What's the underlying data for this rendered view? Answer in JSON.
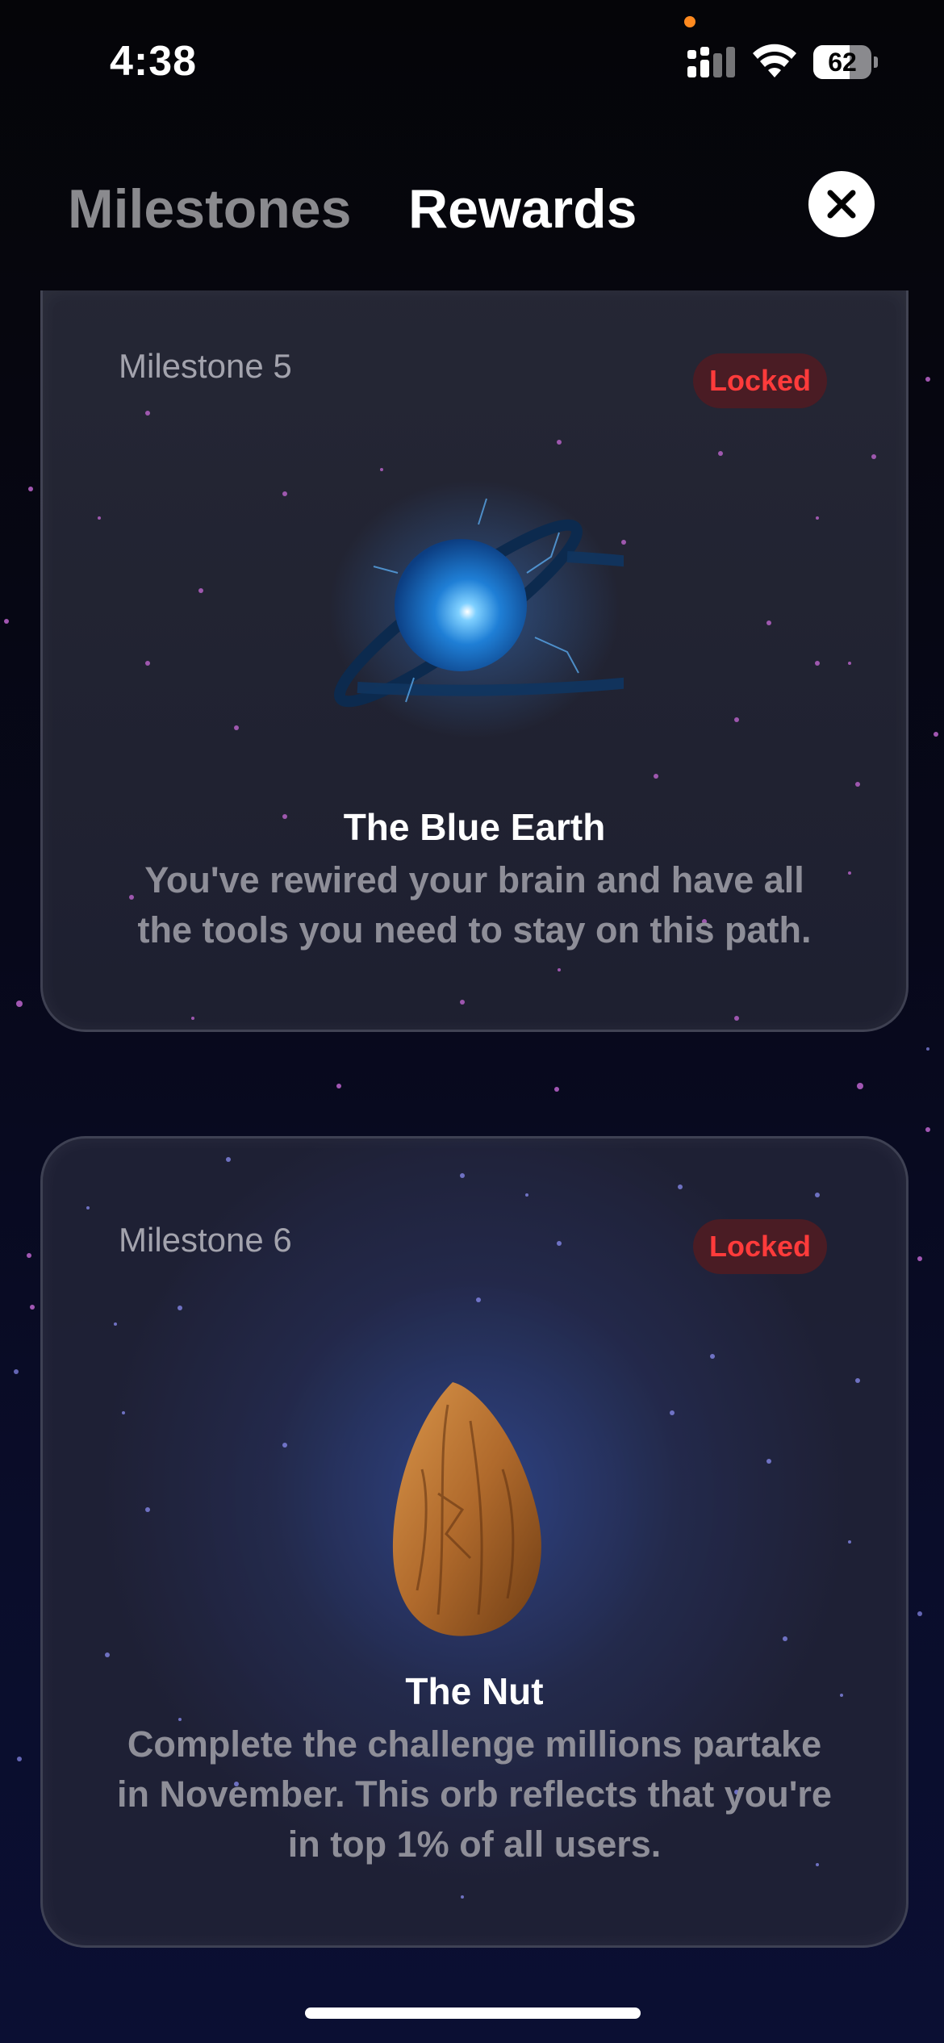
{
  "status_bar": {
    "time": "4:38",
    "battery_level": "62",
    "battery_fraction": 0.62
  },
  "header": {
    "tabs": [
      {
        "label": "Milestones",
        "selected": false
      },
      {
        "label": "Rewards",
        "selected": true
      }
    ],
    "close_icon": "close-icon"
  },
  "rewards": [
    {
      "milestone": "Milestone 5",
      "status": "Locked",
      "title": "The Blue Earth",
      "description": "You've rewired your brain and have all the tools you need to stay on this path.",
      "art_icon": "blue-ringed-planet"
    },
    {
      "milestone": "Milestone 6",
      "status": "Locked",
      "title": "The Nut",
      "description": "Complete the challenge millions partake in November. This orb reflects that you're in top 1% of all users.",
      "art_icon": "almond"
    }
  ],
  "colors": {
    "locked_text": "#ff3b3b",
    "locked_bg": "#4a1c24",
    "star_pink": "#c86ad8",
    "star_blue": "#8a8cf0"
  }
}
